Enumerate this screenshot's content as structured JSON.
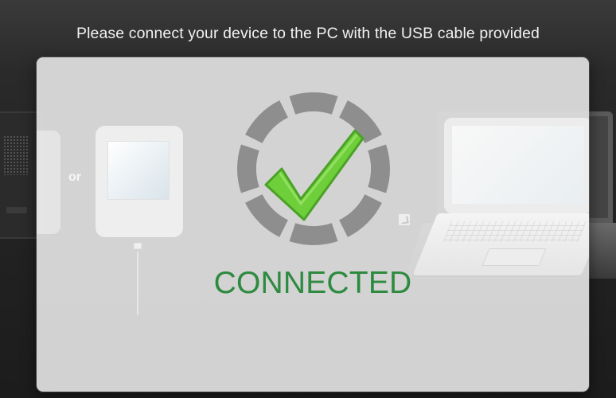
{
  "window": {
    "instruction_text": "Please connect your device to the PC with the USB cable provided"
  },
  "illustration": {
    "or_label": "or"
  },
  "status": {
    "text": "CONNECTED",
    "icon": "checkmark-icon",
    "ring_icon": "progress-ring-icon",
    "color": "#2d8a3f",
    "check_color": "#6fcf3a"
  },
  "colors": {
    "background": "#222222",
    "overlay": "#dedede",
    "instruction_text": "#f2f2f2"
  }
}
